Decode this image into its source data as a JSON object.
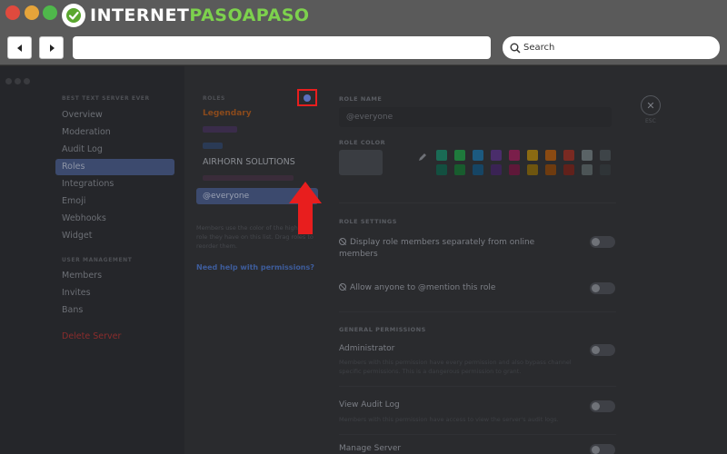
{
  "brand": {
    "text_main": "INTERNET",
    "text_accent": "PASOAPASO"
  },
  "browser": {
    "search_label": "Search"
  },
  "sidebar": {
    "section1_header": "BEST TEXT SERVER EVER",
    "items": [
      {
        "label": "Overview"
      },
      {
        "label": "Moderation"
      },
      {
        "label": "Audit Log"
      },
      {
        "label": "Roles"
      },
      {
        "label": "Integrations"
      },
      {
        "label": "Emoji"
      },
      {
        "label": "Webhooks"
      },
      {
        "label": "Widget"
      }
    ],
    "section2_header": "USER MANAGEMENT",
    "items2": [
      {
        "label": "Members"
      },
      {
        "label": "Invites"
      },
      {
        "label": "Bans"
      }
    ],
    "delete_label": "Delete Server"
  },
  "roles": {
    "title": "ROLES",
    "legendary": "Legendary",
    "airhorn": "AIRHORN SOLUTIONS",
    "everyone": "@everyone",
    "help_text": "Members use the color of the highest role they have on this list. Drag roles to reorder them.",
    "help_link": "Need help with permissions?"
  },
  "editor": {
    "role_name_label": "ROLE NAME",
    "role_name_value": "@everyone",
    "role_color_label": "ROLE COLOR",
    "esc_label": "ESC",
    "role_settings_label": "ROLE SETTINGS",
    "setting1": "Display role members separately from online members",
    "setting2": "Allow anyone to @mention this role",
    "general_permissions_label": "GENERAL PERMISSIONS",
    "admin_title": "Administrator",
    "admin_desc": "Members with this permission have every permission and also bypass channel specific permissions. This is a dangerous permission to grant.",
    "audit_title": "View Audit Log",
    "audit_desc": "Members with this permission have access to view the server's audit logs.",
    "manage_title": "Manage Server"
  },
  "colors": {
    "highlight": "#e81e1e",
    "selected_nav": "#3c4a6e",
    "swatches_row1": [
      "#1a6b55",
      "#1f7a3c",
      "#1c5a80",
      "#4a2d6b",
      "#7a1e4a",
      "#8a6a12",
      "#8a4a12",
      "#7a2a22",
      "#5a6366",
      "#3e4448"
    ],
    "swatches_row2": [
      "#134f40",
      "#185c2e",
      "#164564",
      "#3a2354",
      "#5e1839",
      "#6e550f",
      "#6e3b0f",
      "#61211b",
      "#4c5456",
      "#2f3437"
    ]
  }
}
